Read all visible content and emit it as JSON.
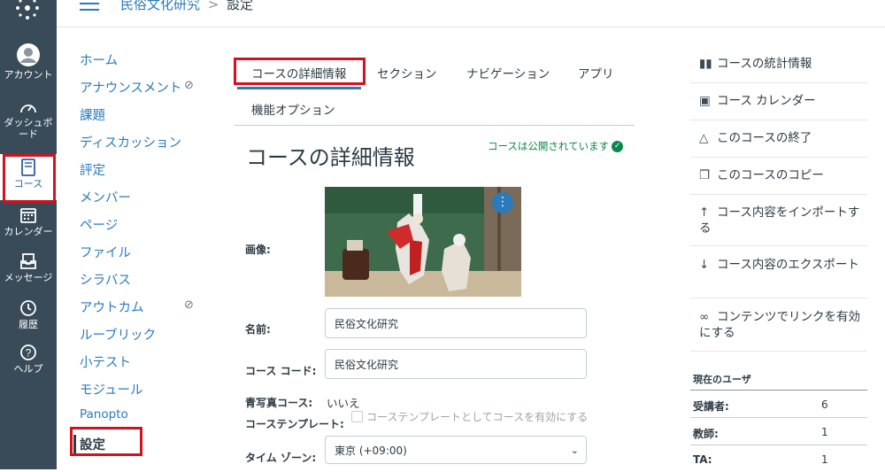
{
  "breadcrumb": {
    "course": "民俗文化研究",
    "separator": ">",
    "current": "設定"
  },
  "global_nav": [
    {
      "id": "account",
      "label": "アカウント",
      "icon": "user-avatar-icon"
    },
    {
      "id": "dashboard",
      "label": "ダッシュボード",
      "icon": "dashboard-gauge-icon"
    },
    {
      "id": "courses",
      "label": "コース",
      "icon": "book-icon"
    },
    {
      "id": "calendar",
      "label": "カレンダー",
      "icon": "calendar-icon"
    },
    {
      "id": "inbox",
      "label": "メッセージ",
      "icon": "inbox-icon"
    },
    {
      "id": "history",
      "label": "履歴",
      "icon": "clock-icon"
    },
    {
      "id": "help",
      "label": "ヘルプ",
      "icon": "question-icon"
    }
  ],
  "course_nav": [
    {
      "label": "ホーム",
      "hidden": false
    },
    {
      "label": "アナウンスメント",
      "hidden": true
    },
    {
      "label": "課題",
      "hidden": false
    },
    {
      "label": "ディスカッション",
      "hidden": false
    },
    {
      "label": "評定",
      "hidden": false
    },
    {
      "label": "メンバー",
      "hidden": false
    },
    {
      "label": "ページ",
      "hidden": false
    },
    {
      "label": "ファイル",
      "hidden": false
    },
    {
      "label": "シラバス",
      "hidden": false
    },
    {
      "label": "アウトカム",
      "hidden": true
    },
    {
      "label": "ルーブリック",
      "hidden": false
    },
    {
      "label": "小テスト",
      "hidden": false
    },
    {
      "label": "モジュール",
      "hidden": false
    },
    {
      "label": "Panopto",
      "hidden": false
    },
    {
      "label": "設定",
      "hidden": false,
      "selected": true
    }
  ],
  "tabs": [
    {
      "label": "コースの詳細情報",
      "active": true
    },
    {
      "label": "セクション"
    },
    {
      "label": "ナビゲーション"
    },
    {
      "label": "アプリ"
    },
    {
      "label": "機能オプション"
    }
  ],
  "page": {
    "title": "コースの詳細情報",
    "published": "コースは公開されています",
    "image_label": "画像:",
    "name_label": "名前:",
    "name_value": "民俗文化研究",
    "code_label": "コース コード:",
    "code_value": "民俗文化研究",
    "blueprint_label": "青写真コース:",
    "blueprint_value": "いいえ",
    "template_label": "コーステンプレート:",
    "template_checkbox": "コーステンプレートとしてコースを有効にする",
    "timezone_label": "タイム ゾーン:",
    "timezone_value": "東京 (+09:00)"
  },
  "sidebar": {
    "links": [
      {
        "label": "コースの統計情報",
        "icon": "bar-chart-icon"
      },
      {
        "label": "コース カレンダー",
        "icon": "calendar-icon"
      },
      {
        "label": "このコースの終了",
        "icon": "lock-icon"
      },
      {
        "label": "このコースのコピー",
        "icon": "copy-icon"
      },
      {
        "label": "コース内容をインポートする",
        "icon": "upload-icon"
      },
      {
        "label": "コース内容のエクスポート",
        "icon": "download-icon"
      },
      {
        "label": "コンテンツでリンクを有効にする",
        "icon": "link-icon"
      }
    ],
    "users_heading": "現在のユーザ",
    "users": [
      {
        "role": "受講者:",
        "count": "6"
      },
      {
        "role": "教師:",
        "count": "1"
      },
      {
        "role": "TA:",
        "count": "1"
      }
    ]
  },
  "colors": {
    "nav_bg": "#394b58",
    "link": "#2b7abc",
    "highlight": "#d0131f",
    "published": "#0b874b"
  }
}
